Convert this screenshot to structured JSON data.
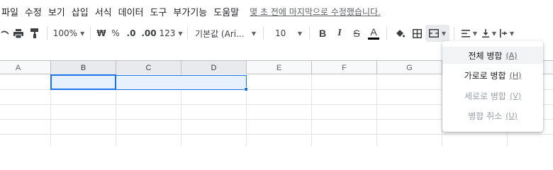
{
  "menubar": {
    "items": [
      "파일",
      "수정",
      "보기",
      "삽입",
      "서식",
      "데이터",
      "도구",
      "부가기능",
      "도움말"
    ],
    "last_edit": "몇 초 전에 마지막으로 수정했습니다."
  },
  "toolbar": {
    "undo_icon": "undo-icon",
    "print_icon": "print-icon",
    "paint_format_icon": "paint-format-icon",
    "zoom": "100%",
    "currency": "₩",
    "percent": "%",
    "decrease_decimals": ".0",
    "increase_decimals": ".00",
    "more_formats": "123",
    "font": "기본값 (Ari...",
    "font_size": "10",
    "bold": "B",
    "italic": "I",
    "strikethrough": "S",
    "text_color": "A",
    "fill_color_icon": "fill-color-icon",
    "borders_icon": "borders-icon",
    "merge_icon": "merge-cells-icon",
    "halign_icon": "align-left-icon",
    "valign_icon": "align-bottom-icon",
    "wrap_icon": "text-wrap-icon"
  },
  "columns": [
    "A",
    "B",
    "C",
    "D",
    "E",
    "F",
    "G"
  ],
  "selection": {
    "range": "B1:D1",
    "active_cell": "B1"
  },
  "merge_menu": {
    "items": [
      {
        "label": "전체 병합",
        "shortcut": "(A)",
        "enabled": true
      },
      {
        "label": "가로로 병합",
        "shortcut": "(H)",
        "enabled": true
      },
      {
        "label": "세로로 병합",
        "shortcut": "(V)",
        "enabled": false
      },
      {
        "label": "병합 취소",
        "shortcut": "(U)",
        "enabled": false
      }
    ]
  },
  "colors": {
    "accent": "#1a73e8",
    "selection_fill": "#e7f0fd",
    "disabled_text": "#9aa0a6"
  }
}
